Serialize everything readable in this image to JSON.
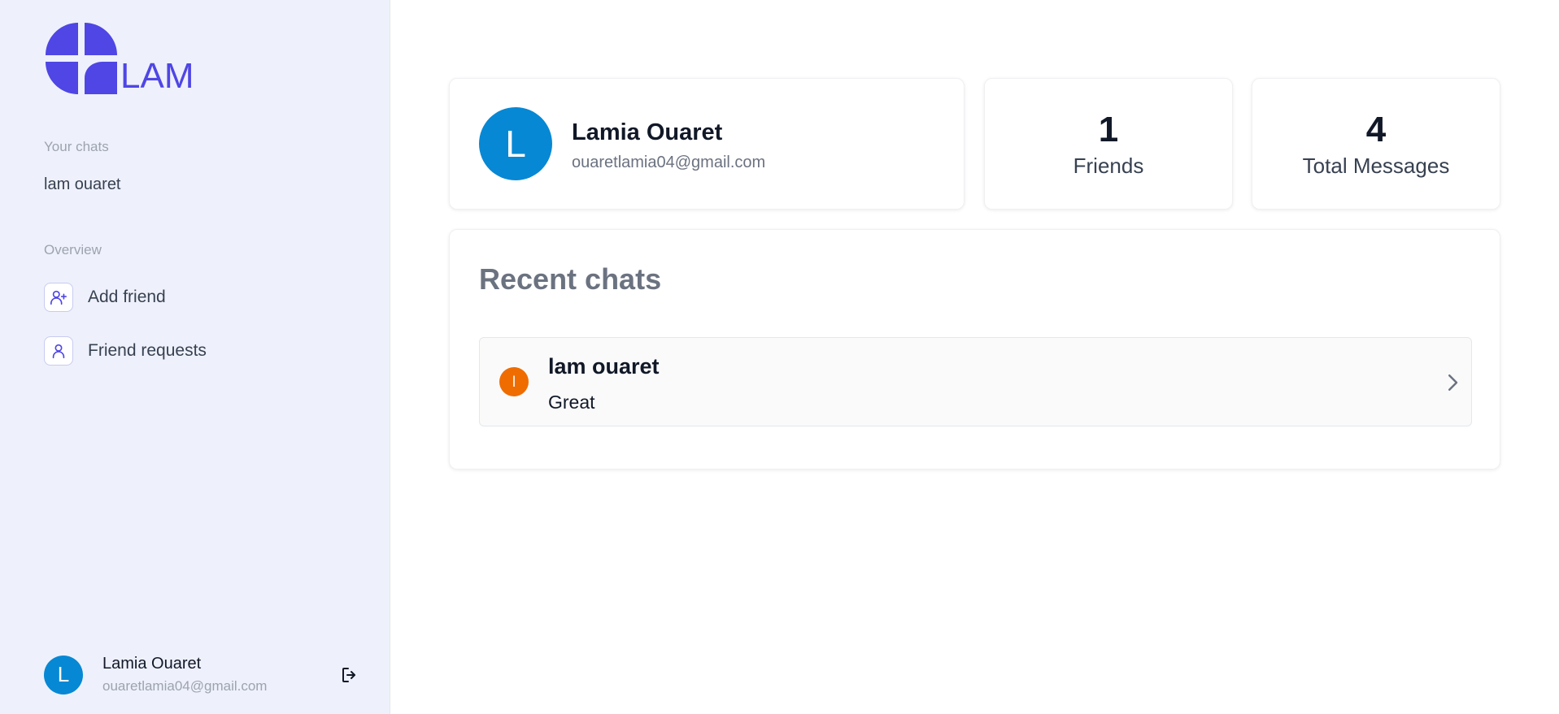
{
  "brand": {
    "logo_text": "LAM",
    "color": "#4f46e5"
  },
  "sidebar": {
    "chats_label": "Your chats",
    "chats": [
      {
        "name": "lam ouaret"
      }
    ],
    "overview_label": "Overview",
    "items": [
      {
        "label": "Add friend",
        "icon": "user-plus-icon"
      },
      {
        "label": "Friend requests",
        "icon": "user-icon"
      }
    ],
    "user": {
      "initial": "L",
      "name": "Lamia Ouaret",
      "email": "ouaretlamia04@gmail.com",
      "avatar_color": "#0788d4"
    },
    "logout_icon": "logout-icon"
  },
  "profile": {
    "initial": "L",
    "name": "Lamia Ouaret",
    "email": "ouaretlamia04@gmail.com"
  },
  "stats": {
    "friends_value": "1",
    "friends_label": "Friends",
    "messages_value": "4",
    "messages_label": "Total Messages"
  },
  "recent": {
    "title": "Recent chats",
    "chats": [
      {
        "initial": "l",
        "name": "lam ouaret",
        "last_message": "Great",
        "avatar_color": "#ef6c00"
      }
    ]
  }
}
